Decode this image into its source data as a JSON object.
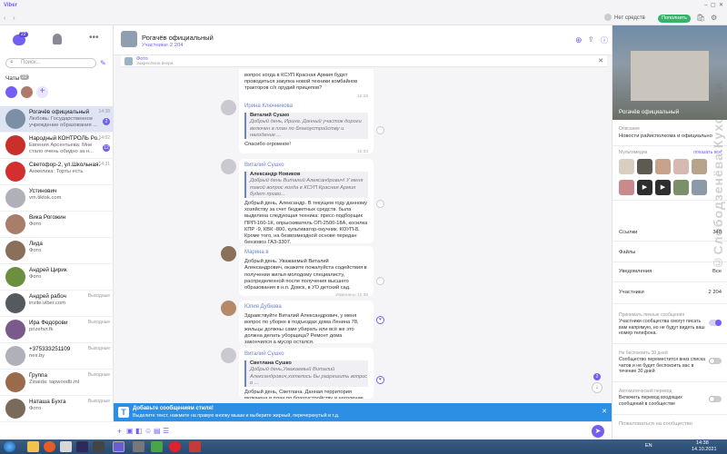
{
  "app": {
    "title": "Viber"
  },
  "titlebar": {
    "status": "Нет средств",
    "pay_label": "Пополнить"
  },
  "sidebar": {
    "unread_count": "22",
    "search_placeholder": "Поиск...",
    "chats_label": "Чаты",
    "chats": [
      {
        "name": "Рогачёв официальный",
        "preview": "Любовь: Государственное учреждение образования ...",
        "time": "14:38",
        "badge": "2",
        "selected": true,
        "color": "#7b8fa6"
      },
      {
        "name": "Народный КОНТРОЛЬ Ро...",
        "preview": "Евгения Арсентьева: Мне стало очень обидно за н...",
        "time": "14:02",
        "badge": "12",
        "selected": false,
        "color": "#c9302c"
      },
      {
        "name": "Светофор-2, ул.Школьная...",
        "preview": "Анжелика: Торты есть",
        "time": "14:31",
        "badge": "",
        "selected": false,
        "color": "#d32f2f"
      },
      {
        "name": "Устинович",
        "preview": "vm.tiktok.com",
        "time": "",
        "badge": "",
        "selected": false,
        "color": "#b0b0b8"
      },
      {
        "name": "Вика Рогожин",
        "preview": "Фото",
        "time": "",
        "badge": "",
        "selected": false,
        "color": "#a87d6a"
      },
      {
        "name": "Лида",
        "preview": "Фото",
        "time": "",
        "badge": "",
        "selected": false,
        "color": "#8a6f5a"
      },
      {
        "name": "Андрей Цирик",
        "preview": "Фото",
        "time": "",
        "badge": "",
        "selected": false,
        "color": "#6c8f3f"
      },
      {
        "name": "Андрей рабоч",
        "preview": "invite.viber.com",
        "time": "Выходные",
        "badge": "",
        "selected": false,
        "color": "#555a5f"
      },
      {
        "name": "Ира Федорови",
        "preview": "prizehvr.fk",
        "time": "Выходные",
        "badge": "",
        "selected": false,
        "color": "#7a5a8a"
      },
      {
        "name": "+375333251109",
        "preview": "nex.by",
        "time": "Выходные",
        "badge": "",
        "selected": false,
        "color": "#b0b0b8"
      },
      {
        "name": "Группа",
        "preview": "Zinaida: tapwoodb.ml",
        "time": "Выходные",
        "badge": "",
        "selected": false,
        "color": "#9a6b4a"
      },
      {
        "name": "Наташа Бухга",
        "preview": "Фото",
        "time": "Выходные",
        "badge": "",
        "selected": false,
        "color": "#7a6a5a"
      }
    ]
  },
  "chat": {
    "title": "Рогачёв официальный",
    "participants": "Участники: 2 204",
    "pinned_label": "Фото",
    "pinned_sub": "Закреплено вчера",
    "messages": [
      {
        "sender": "",
        "quote_name": "",
        "quote_text": "",
        "text": "вопрос когда в КСУП Красная Армия будет проводиться закупка новой техники комбайнов тракторов с/х орудий прицепов?",
        "time": "12:28",
        "reaction": ""
      },
      {
        "sender": "Ирина Ключникова",
        "quote_name": "Виталий Сушко",
        "quote_text": "Добрый день, Ирина. Данный участок дороги включен в план по благоустройству и нагодение ...",
        "text": "Спасибо огромное!",
        "time": "12:33",
        "reaction": ""
      },
      {
        "sender": "Виталий Сушко",
        "quote_name": "Александр Новиков",
        "quote_text": "Добрый день Виталий Александрович! У меня такой вопрос когда в КСУП Красная Армия будет прово...",
        "text": "Добрый день, Александр. В текущем году данному хозяйству за счет бюджетных средств. была выделена следующая техника: пресс-подборщик ПРП-160-1К, опрыскиватель ОП-2500-18А, косилка КПР -9, КВК -800, культиватор-окучник. КОУП-8. Кроме того, на безвозмездной основе передан бензовоз ГАЗ-3307.",
        "time": "12:34",
        "reaction": ""
      },
      {
        "sender": "Марина в",
        "quote_name": "",
        "quote_text": "",
        "text": "Добрый день. Уважаемый Виталий Александрович, окажите пожалуйста содействия в получении жилья молодому специалисту, распределенной после получения высшего образования в н.п. Довск, в УО детский сад.",
        "time": "Изменено 12:36",
        "reaction": ""
      },
      {
        "sender": "Юлия Дубкова",
        "quote_name": "",
        "quote_text": "",
        "text": "Здравствуйте Виталий Александрович, у меня вопрос по уборке в подъездах дома Ленина 78, жильцы должны сами убирать или всё же это должна делать уборщица? Ремонт дома закончился а мусор остался.",
        "time": "12:36",
        "reaction": "♥"
      },
      {
        "sender": "Виталий Сушко",
        "quote_name": "Светлана Сушко",
        "quote_text": "Добрый день,Уважаемый Виталий Александрович,хотелось бы разрешить вопрос о ...",
        "text": "Добрый день, Светлана. Данная территория включена в план по благоустройству и нагодение",
        "time": "",
        "reaction": "♥"
      }
    ],
    "scroll_badge": "2",
    "banner_title": "Добавьте сообщениям стиля!",
    "banner_text": "Выделите текст, нажмите на правую кнопку мыши и выберите жирный, перечеркнутый и т.д."
  },
  "info": {
    "cover_title": "Рогачёв официальный",
    "description_label": "Описание",
    "description_text": "Новости райисполкома и официально",
    "media_label": "Мультимедиа",
    "show_all": "показать все",
    "links_label": "Ссылки",
    "links_count": "348",
    "files_label": "Файлы",
    "notifications_label": "Уведомления",
    "notifications_value": "Все",
    "members_label": "Участники",
    "members_count": "2 204",
    "private_label": "Принимать личные сообщения",
    "private_text": "Участники сообщества смогут писать вам напрямую, но не будут видеть ваш номер телефона.",
    "disappear_label": "Не беспокоить 30 дней",
    "disappear_text": "Сообщество переместится вниз списка чатов и не будет беспокоить вас в течение 30 дней",
    "translate_label": "Автоматический перевод",
    "translate_text": "Включить перевод входящих сообщений в сообществе",
    "report_label": "Пожаловаться на сообщество"
  },
  "taskbar": {
    "lang": "EN",
    "time": "14:38",
    "date": "14.10.2021"
  },
  "watermark": "©Слободзенёва.Кухоньки"
}
